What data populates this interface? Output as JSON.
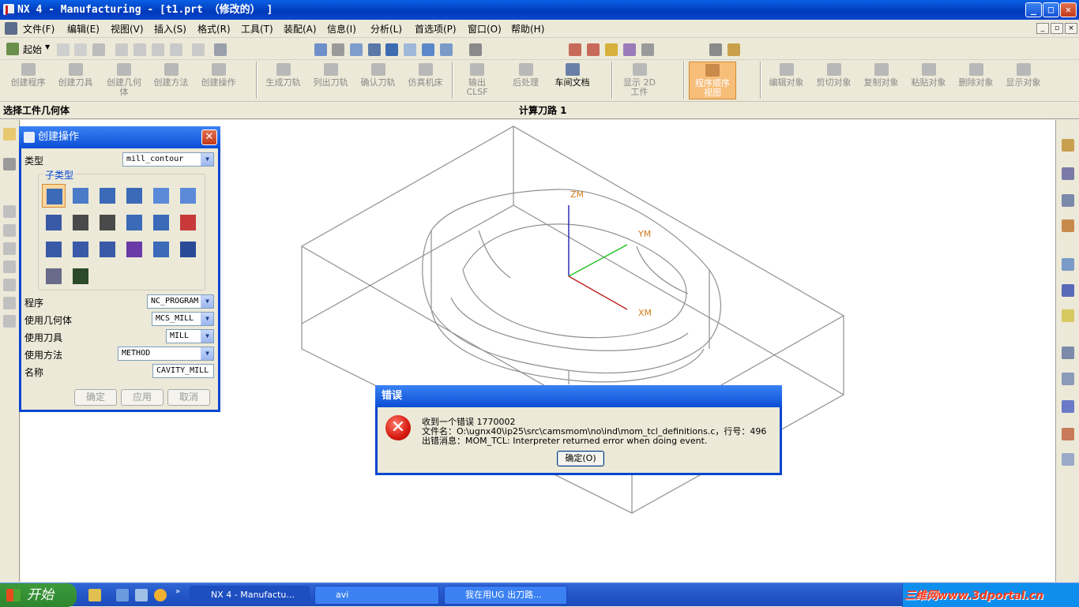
{
  "window": {
    "title": "NX 4 - Manufacturing - [t1.prt （修改的） ]",
    "min": "_",
    "max": "□",
    "close": "✕"
  },
  "menu": [
    "文件(F)",
    "编辑(E)",
    "视图(V)",
    "插入(S)",
    "格式(R)",
    "工具(T)",
    "装配(A)",
    "信息(I)",
    "分析(L)",
    "首选项(P)",
    "窗口(O)",
    "帮助(H)"
  ],
  "toolbar1": {
    "start_label": "起始"
  },
  "toolbar2": {
    "create": [
      "创建程序",
      "创建刀具",
      "创建几何\n体",
      "创建方法",
      "创建操作"
    ],
    "toolpath": [
      "生成刀轨",
      "列出刀轨",
      "确认刀轨",
      "仿真机床"
    ],
    "post": [
      "输出\nCLSF",
      "后处理",
      "车间文档"
    ],
    "display2d": "显示 2D\n工件",
    "program_order": "程序顺序\n视图",
    "objects": [
      "编辑对象",
      "剪切对象",
      "复制对象",
      "粘贴对象",
      "删除对象",
      "显示对象"
    ]
  },
  "status": {
    "prompt": "选择工件几何体",
    "message": "计算刀路 1"
  },
  "dialog": {
    "title": "创建操作",
    "type_label": "类型",
    "type_value": "mill_contour",
    "subtype_label": "子类型",
    "program_label": "程序",
    "program_value": "NC_PROGRAM",
    "geometry_label": "使用几何体",
    "geometry_value": "MCS_MILL",
    "tool_label": "使用刀具",
    "tool_value": "MILL",
    "method_label": "使用方法",
    "method_value": "METHOD",
    "name_label": "名称",
    "name_value": "CAVITY_MILL",
    "ok": "确定",
    "apply": "应用",
    "cancel": "取消"
  },
  "viewport": {
    "axes": {
      "z": "ZM",
      "y": "YM",
      "x": "XM"
    }
  },
  "error": {
    "title": "错误",
    "line1": "收到一个错误 1770002",
    "line2": "文件名：O:\\ugnx40\\ip25\\src\\camsmom\\no\\ind\\mom_tcl_definitions.c，行号：496",
    "line3": "出错消息：MOM_TCL: Interpreter returned error when doing event.",
    "ok": "确定(O)"
  },
  "taskbar": {
    "start": "开始",
    "tasks": [
      "NX 4 - Manufactu...",
      "avi",
      "我在用UG 出刀路..."
    ]
  },
  "watermark": "三维网www.3dportal.cn"
}
